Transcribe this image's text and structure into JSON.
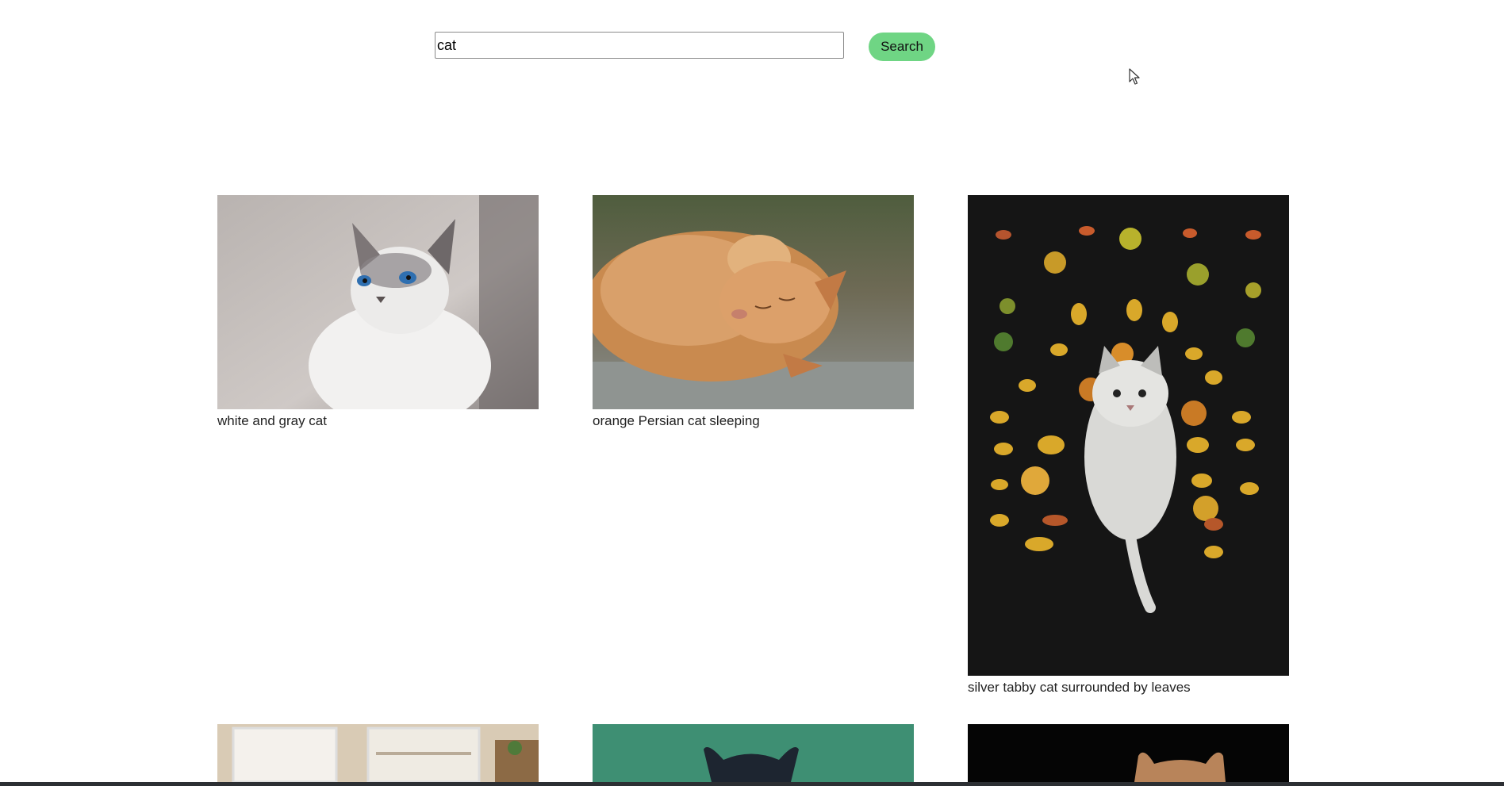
{
  "search": {
    "query": "cat",
    "button_label": "Search"
  },
  "results": [
    {
      "caption": "white and gray cat"
    },
    {
      "caption": "orange Persian cat sleeping"
    },
    {
      "caption": "silver tabby cat surrounded by leaves"
    },
    {
      "caption": ""
    },
    {
      "caption": ""
    },
    {
      "caption": ""
    }
  ],
  "colors": {
    "search_button": "#6fd584",
    "input_border": "#8a8a8a"
  }
}
